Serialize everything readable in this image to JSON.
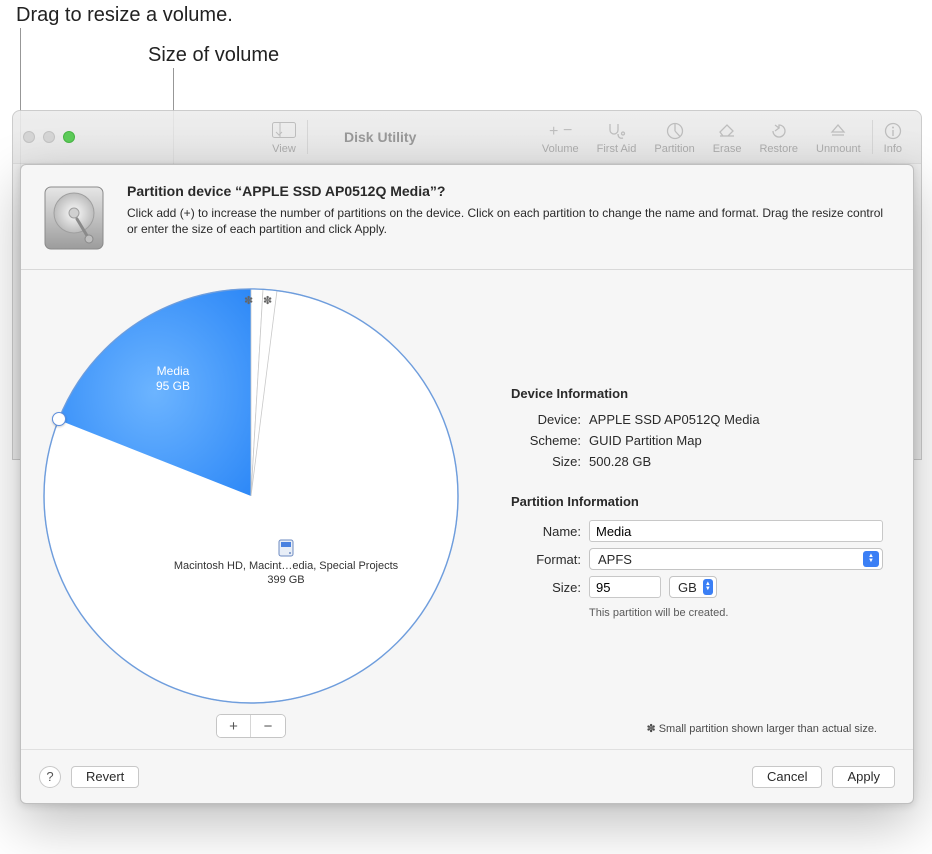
{
  "annotations": {
    "drag_resize": "Drag to resize a volume.",
    "size_of_volume": "Size of volume"
  },
  "toolbar": {
    "app_title": "Disk Utility",
    "view": "View",
    "volume": "Volume",
    "first_aid": "First Aid",
    "partition": "Partition",
    "erase": "Erase",
    "restore": "Restore",
    "unmount": "Unmount",
    "info": "Info"
  },
  "dialog": {
    "title": "Partition device “APPLE SSD AP0512Q Media”?",
    "subtitle": "Click add (+) to increase the number of partitions on the device. Click on each partition to change the name and format. Drag the resize control or enter the size of each partition and click Apply."
  },
  "device_info": {
    "heading": "Device Information",
    "device_label": "Device:",
    "device": "APPLE SSD AP0512Q Media",
    "scheme_label": "Scheme:",
    "scheme": "GUID Partition Map",
    "size_label": "Size:",
    "size": "500.28 GB"
  },
  "partition_info": {
    "heading": "Partition Information",
    "name_label": "Name:",
    "name_value": "Media",
    "format_label": "Format:",
    "format_value": "APFS",
    "size_label": "Size:",
    "size_value": "95",
    "size_unit": "GB",
    "note": "This partition will be created."
  },
  "pie": {
    "selected_name": "Media",
    "selected_size": "95 GB",
    "main_label": "Macintosh HD, Macint…edia, Special Projects",
    "main_size": "399 GB"
  },
  "footnote": "✽ Small partition shown larger than actual size.",
  "footer": {
    "revert": "Revert",
    "cancel": "Cancel",
    "apply": "Apply"
  },
  "add_label": "+",
  "remove_label": "−",
  "help_label": "?",
  "chart_data": {
    "type": "pie",
    "title": "Partition layout",
    "slices": [
      {
        "name": "Media",
        "value": 95,
        "unit": "GB",
        "selected": true
      },
      {
        "name": "Macintosh HD, Macint…edia, Special Projects",
        "value": 399,
        "unit": "GB",
        "selected": false
      }
    ],
    "small_partitions_note": true
  }
}
